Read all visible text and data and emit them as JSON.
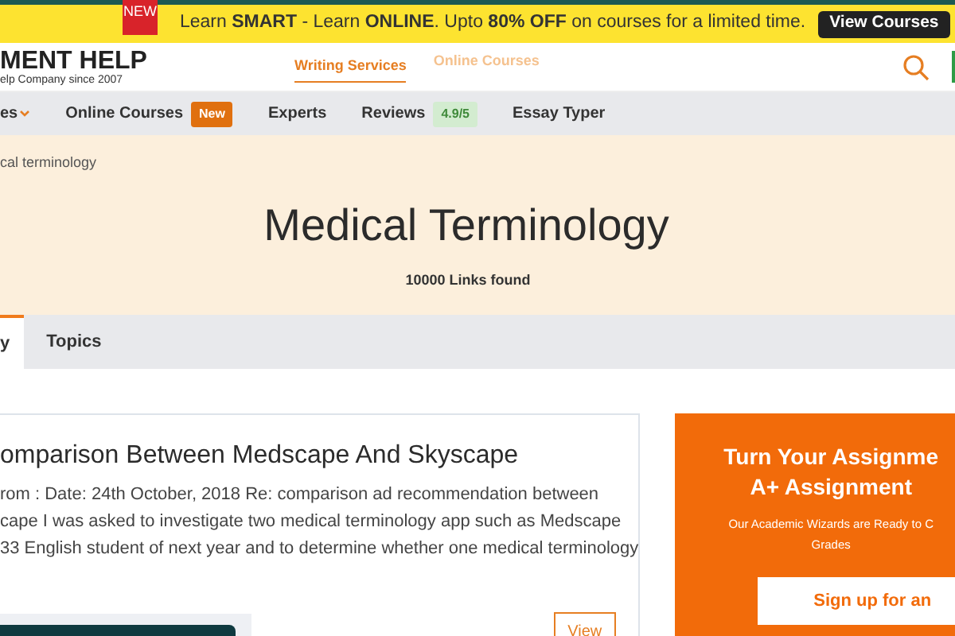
{
  "promo_bar": {
    "badge": "NEW",
    "text": "Learn **SMART** - Learn **ONLINE**. Upto **80% OFF** on courses for a limited time.",
    "button": "View Courses"
  },
  "header": {
    "logo_title": "MENT HELP",
    "logo_tagline": "elp Company since 2007",
    "tabs": [
      {
        "label": "Writing Services",
        "selected": true
      },
      {
        "label": "Online Courses",
        "selected": false
      }
    ]
  },
  "nav": {
    "items": [
      {
        "label": "es",
        "kind": "dropdown"
      },
      {
        "label": "Online Courses",
        "kind": "badge",
        "badge": "New"
      },
      {
        "label": "Experts",
        "kind": "plain"
      },
      {
        "label": "Reviews",
        "kind": "rating",
        "badge": "4.9/5"
      },
      {
        "label": "Essay Typer",
        "kind": "plain"
      }
    ]
  },
  "hero": {
    "breadcrumb": "cal terminology",
    "title": "Medical Terminology",
    "count": "10000 Links found"
  },
  "tabs": [
    {
      "label": "y",
      "selected": true
    },
    {
      "label": "Topics",
      "selected": false
    }
  ],
  "result": {
    "title": "omparison Between Medscape And Skyscape",
    "lines": [
      "rom : Date: 24th October, 2018 Re: comparison ad recommendation between",
      "cape I was asked to investigate two medical terminology app such as Medscape",
      "33 English student of next year and to determine whether one medical terminology"
    ],
    "button": "View"
  },
  "promo_panel": {
    "title_lines": [
      "Turn Your Assignme",
      "A+ Assignment"
    ],
    "text_lines": [
      "Our Academic Wizards are Ready to C",
      "Grades"
    ],
    "button": "Sign up for an"
  }
}
